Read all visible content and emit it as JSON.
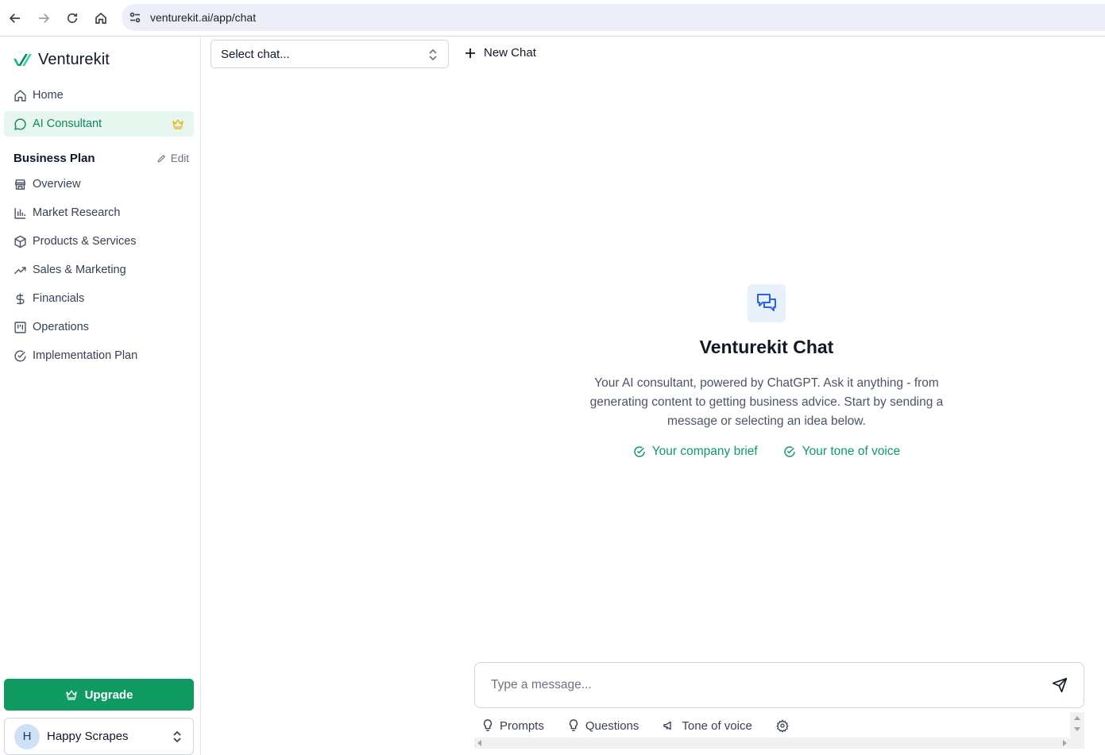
{
  "browser": {
    "url": "venturekit.ai/app/chat",
    "icons": [
      "back-arrow-icon",
      "forward-arrow-icon",
      "reload-icon",
      "home-icon",
      "site-settings-icon"
    ]
  },
  "sidebar": {
    "brand": "Venturekit",
    "top_items": [
      {
        "label": "Home",
        "icon": "home-icon"
      },
      {
        "label": "AI Consultant",
        "icon": "chat-bubble-icon",
        "active": true,
        "badge_icon": "crown-icon"
      }
    ],
    "section_title": "Business Plan",
    "edit_label": "Edit",
    "plan_items": [
      {
        "label": "Overview",
        "icon": "store-icon"
      },
      {
        "label": "Market Research",
        "icon": "bar-chart-icon"
      },
      {
        "label": "Products & Services",
        "icon": "box-icon"
      },
      {
        "label": "Sales & Marketing",
        "icon": "trend-up-icon"
      },
      {
        "label": "Financials",
        "icon": "dollar-icon"
      },
      {
        "label": "Operations",
        "icon": "kanban-icon"
      },
      {
        "label": "Implementation Plan",
        "icon": "check-circle-icon"
      }
    ],
    "upgrade_label": "Upgrade",
    "account": {
      "initial": "H",
      "name": "Happy Scrapes"
    }
  },
  "main": {
    "chat_select_placeholder": "Select chat...",
    "new_chat_label": "New Chat",
    "empty_state": {
      "title": "Venturekit Chat",
      "description": "Your AI consultant, powered by ChatGPT. Ask it anything - from generating content to getting business advice. Start by sending a message or selecting an idea below.",
      "badges": [
        "Your company brief",
        "Your tone of voice"
      ]
    },
    "composer": {
      "placeholder": "Type a message..."
    },
    "tools": [
      "Prompts",
      "Questions",
      "Tone of voice"
    ]
  },
  "colors": {
    "accent": "#0f9a62",
    "active_bg": "#e6f5ee",
    "crown": "#eab308",
    "chat_icon": "#2563eb"
  }
}
